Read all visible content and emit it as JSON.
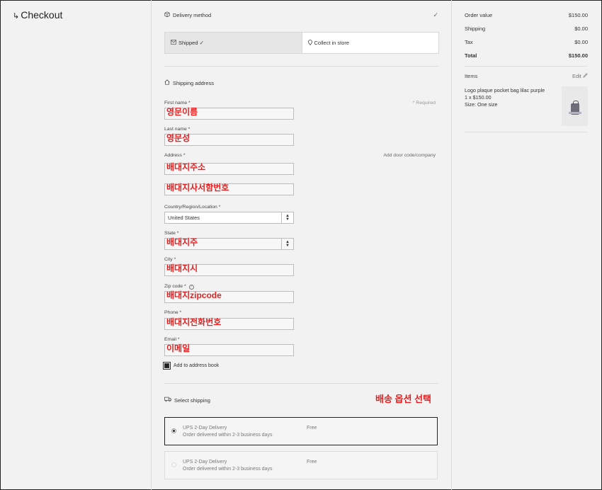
{
  "brand": {
    "arrow": "↳",
    "title": "Checkout"
  },
  "delivery": {
    "heading": "Delivery method",
    "checkmark": "✓",
    "tabs": [
      {
        "label": "Shipped ✓",
        "active": true
      },
      {
        "label": "Collect in store",
        "active": false
      }
    ]
  },
  "address": {
    "heading": "Shipping address",
    "required_note": "* Required",
    "first_name_label": "First name *",
    "first_name_annot": "영문이름",
    "last_name_label": "Last name *",
    "last_name_annot": "영문성",
    "address_label": "Address *",
    "address_hint": "Add door code/company",
    "address_annot": "배대지주소",
    "address2_annot": "배대지사서함번호",
    "country_label": "Country/Region/Location *",
    "country_value": "United States",
    "state_label": "State *",
    "state_annot": "배대지주",
    "city_label": "City *",
    "city_annot": "배대지시",
    "zip_label": "Zip code *",
    "zip_annot": "배대지zipcode",
    "phone_label": "Phone *",
    "phone_annot": "배대지전화번호",
    "email_label": "Email *",
    "email_annot": "이메일",
    "add_to_book": "Add to address book"
  },
  "shipping": {
    "heading": "Select shipping",
    "annotation": "배송 옵션 선택",
    "options": [
      {
        "name": "UPS 2-Day Delivery",
        "desc": "Order delivered within 2-3 business days",
        "price": "Free",
        "selected": true
      },
      {
        "name": "UPS 2-Day Delivery",
        "desc": "Order delivered within 2-3 business days",
        "price": "Free",
        "selected": false
      }
    ]
  },
  "summary": {
    "rows": [
      {
        "label": "Order value",
        "value": "$150.00"
      },
      {
        "label": "Shipping",
        "value": "$0.00"
      },
      {
        "label": "Tax",
        "value": "$0.00"
      },
      {
        "label": "Total",
        "value": "$150.00"
      }
    ],
    "items_label": "Items",
    "edit_label": "Edit",
    "item": {
      "name": "Logo plaque pocket bag lilac purple",
      "qty": "1 x $150.00",
      "size": "Size: One size"
    }
  }
}
